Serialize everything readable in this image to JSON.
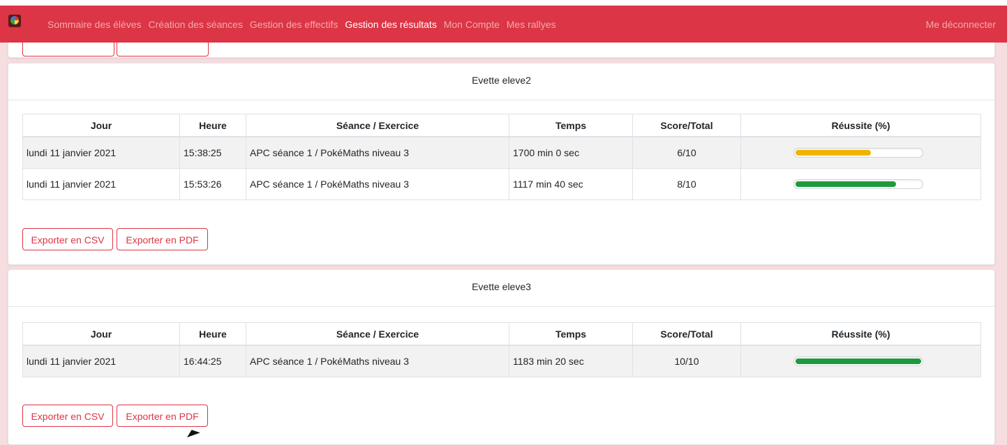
{
  "nav": {
    "items": [
      "Sommaire des élèves",
      "Création des séances",
      "Gestion des effectifs",
      "Gestion des résultats",
      "Mon Compte",
      "Mes rallyes"
    ],
    "active_index": 3,
    "logout": "Me déconnecter"
  },
  "table_headers": [
    "Jour",
    "Heure",
    "Séance / Exercice",
    "Temps",
    "Score/Total",
    "Réussite (%)"
  ],
  "buttons": {
    "csv": "Exporter en CSV",
    "pdf": "Exporter en PDF"
  },
  "students": [
    {
      "name": "Evette eleve2",
      "rows": [
        {
          "jour": "lundi 11 janvier 2021",
          "heure": "15:38:25",
          "exercice": "APC séance 1 / PokéMaths niveau 3",
          "temps": "1700 min 0 sec",
          "score": "6/10",
          "pct": 60,
          "color": "#f0b400"
        },
        {
          "jour": "lundi 11 janvier 2021",
          "heure": "15:53:26",
          "exercice": "APC séance 1 / PokéMaths niveau 3",
          "temps": "1117 min 40 sec",
          "score": "8/10",
          "pct": 80,
          "color": "#1e9a3c"
        }
      ]
    },
    {
      "name": "Evette eleve3",
      "rows": [
        {
          "jour": "lundi 11 janvier 2021",
          "heure": "16:44:25",
          "exercice": "APC séance 1 / PokéMaths niveau 3",
          "temps": "1183 min 20 sec",
          "score": "10/10",
          "pct": 100,
          "color": "#1e9a3c"
        }
      ]
    }
  ]
}
